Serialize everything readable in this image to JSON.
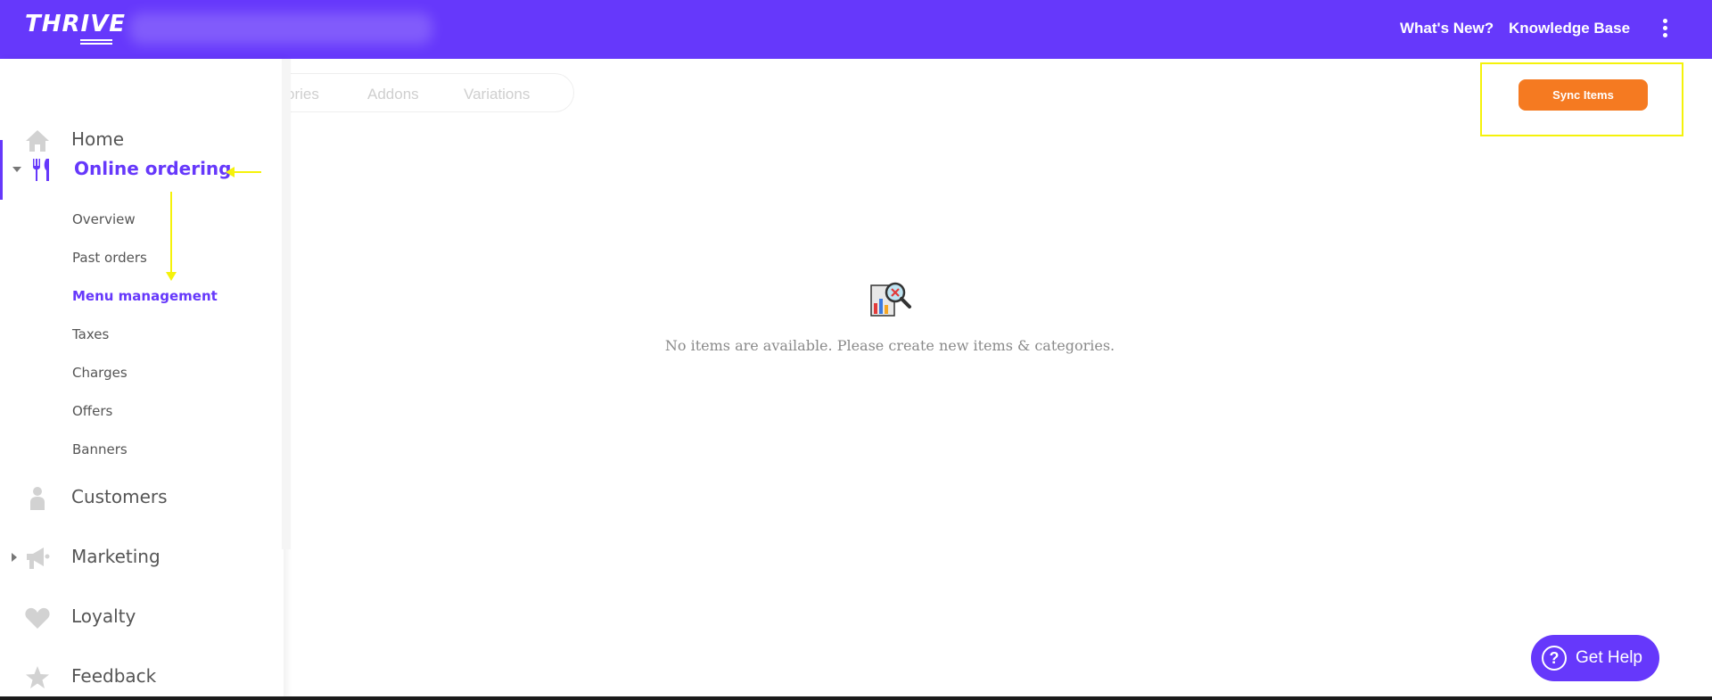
{
  "header": {
    "logo_text": "THRIVE",
    "links": [
      "What's New?",
      "Knowledge Base"
    ],
    "more_icon": "kebab-menu-icon"
  },
  "tabs": [
    "ories",
    "Addons",
    "Variations"
  ],
  "toolbar": {
    "sync_label": "Sync Items"
  },
  "empty_state": {
    "icon": "no-items-search-icon",
    "message": "No items are available. Please create new items & categories."
  },
  "sidebar": {
    "items": [
      {
        "label": "Home",
        "icon": "home-icon"
      },
      {
        "label": "Online ordering",
        "icon": "fork-knife-icon",
        "expanded": true
      },
      {
        "label": "Customers",
        "icon": "person-icon"
      },
      {
        "label": "Marketing",
        "icon": "megaphone-icon"
      },
      {
        "label": "Loyalty",
        "icon": "heart-icon"
      },
      {
        "label": "Feedback",
        "icon": "star-icon"
      }
    ],
    "sub_items": [
      "Overview",
      "Past orders",
      "Menu management",
      "Taxes",
      "Charges",
      "Offers",
      "Banners"
    ],
    "active_sub": "Menu management"
  },
  "help": {
    "label": "Get Help",
    "icon_glyph": "?"
  },
  "colors": {
    "brand": "#6638fb",
    "sync": "#f57a21",
    "annotation": "#f5f20a"
  }
}
